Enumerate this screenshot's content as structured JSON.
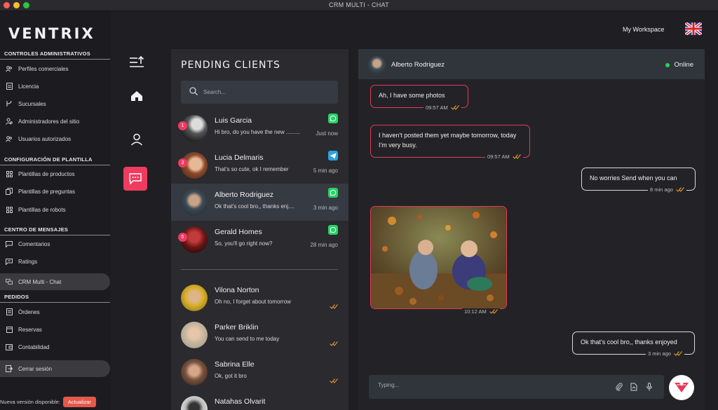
{
  "window": {
    "title": "CRM MULTI - CHAT"
  },
  "brand": {
    "logo": "VENTRIX"
  },
  "sidebar": {
    "sections": [
      {
        "title": "CONTROLES ADMINISTRATIVOS",
        "items": [
          {
            "label": "Perfiles comerciales",
            "icon": "users-icon"
          },
          {
            "label": "Licencia",
            "icon": "document-icon"
          },
          {
            "label": "Sucursales",
            "icon": "branch-icon"
          },
          {
            "label": "Administradores del sitio",
            "icon": "admin-icon"
          },
          {
            "label": "Usuarios autorizados",
            "icon": "users-icon"
          }
        ]
      },
      {
        "title": "CONFIGURACIÓN DE PLANTILLA",
        "items": [
          {
            "label": "Plantillas de productos",
            "icon": "grid-icon"
          },
          {
            "label": "Plantillas de preguntas",
            "icon": "copy-icon"
          },
          {
            "label": "Plantillas de robots",
            "icon": "grid-icon"
          }
        ]
      },
      {
        "title": "CENTRO DE MENSAJES",
        "items": [
          {
            "label": "Comentarios",
            "icon": "comment-icon"
          },
          {
            "label": "Ratings",
            "icon": "rating-icon"
          },
          {
            "label": "CRM Multi - Chat",
            "icon": "chat-icon",
            "active": true
          }
        ]
      },
      {
        "title": "PEDIDOS",
        "items": [
          {
            "label": "Órdenes",
            "icon": "list-icon"
          },
          {
            "label": "Reservas",
            "icon": "calendar-icon"
          },
          {
            "label": "Contabilidad",
            "icon": "wallet-icon"
          }
        ]
      }
    ],
    "logout": "Cerrar sesión",
    "update_text": "Nueva versión disponible:",
    "update_button": "Actualizar"
  },
  "header": {
    "workspace": "My Workspace",
    "language_flag": "uk-flag-icon"
  },
  "clients": {
    "title": "PENDING CLIENTS",
    "search_placeholder": "Search...",
    "pending": [
      {
        "name": "Luis Garcia",
        "message": "Hi bro, do you have the new .........",
        "time": "Just now",
        "badge": "1",
        "app": "whatsapp",
        "color": "#8a8a8a"
      },
      {
        "name": "Lucia Delmaris",
        "message": "That's so cute, ok I remember",
        "time": "5 min ago",
        "badge": "3",
        "app": "telegram",
        "color": "#b9744d"
      },
      {
        "name": "Alberto Rodriguez",
        "message": "Ok that's cool bro,, thanks enj....",
        "time": "3 min ago",
        "badge": "",
        "app": "whatsapp",
        "color": "#4a5560"
      },
      {
        "name": "Gerald Homes",
        "message": "So, you'll go right now?",
        "time": "28 min ago",
        "badge": "5",
        "app": "whatsapp",
        "color": "#7a1d1d"
      }
    ],
    "others": [
      {
        "name": "Vilona Norton",
        "message": "Oh no, I forget about tomorrow",
        "color": "#d9b53a"
      },
      {
        "name": "Parker Briklin",
        "message": "You can send to me today",
        "color": "#c9b8a2"
      },
      {
        "name": "Sabrina Elle",
        "message": "Ok, got it bro",
        "color": "#8d6a55"
      },
      {
        "name": "Natahas Olvarit",
        "message": "",
        "color": "#d8d8d8"
      }
    ]
  },
  "chat": {
    "contact": "Alberto Rodriguez",
    "status": "Online",
    "messages": [
      {
        "text": "Ah, I have some photos",
        "time": "09:57 AM"
      },
      {
        "text": "I haven't posted them yet maybe tomorrow, today I'm very busy.",
        "time": "09:57 AM"
      },
      {
        "text": "No worries Send when you can",
        "time": "8 min ago"
      },
      {
        "text": "",
        "time": "10:12 AM"
      },
      {
        "text": "Ok that's cool bro,, thanks enjoyed",
        "time": "3 min ago"
      }
    ],
    "composer_placeholder": "Typing..."
  },
  "colors": {
    "accent": "#ef3b5f",
    "online": "#2fcf52",
    "whatsapp": "#25d366",
    "telegram": "#2aa3e0",
    "read_check": "#f0a030"
  }
}
